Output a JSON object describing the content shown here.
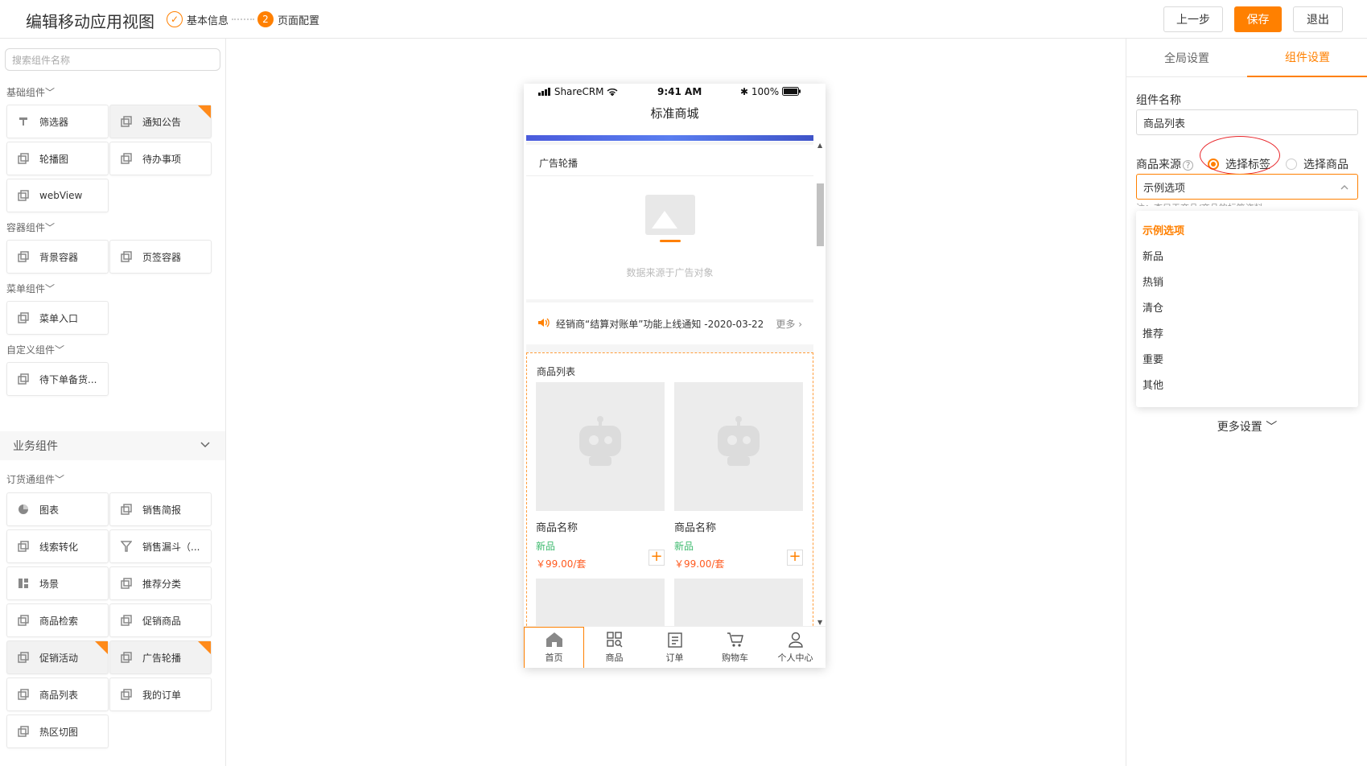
{
  "header": {
    "title": "编辑移动应用视图",
    "step1": "基本信息",
    "step2_num": "2",
    "step2": "页面配置",
    "prev": "上一步",
    "save": "保存",
    "exit": "退出"
  },
  "left": {
    "search_placeholder": "搜索组件名称",
    "groups": {
      "basic": "基础组件",
      "container": "容器组件",
      "menu": "菜单组件",
      "custom": "自定义组件",
      "business": "业务组件",
      "order": "订货通组件"
    },
    "basic_items": [
      "筛选器",
      "通知公告",
      "轮播图",
      "待办事项",
      "webView"
    ],
    "container_items": [
      "背景容器",
      "页签容器"
    ],
    "menu_items": [
      "菜单入口"
    ],
    "custom_items": [
      "待下单备货..."
    ],
    "order_items": [
      "图表",
      "销售简报",
      "线索转化",
      "销售漏斗（...",
      "场景",
      "推荐分类",
      "商品检索",
      "促销商品",
      "促销活动",
      "广告轮播",
      "商品列表",
      "我的订单",
      "热区切图"
    ]
  },
  "phone": {
    "carrier": "ShareCRM",
    "time": "9:41 AM",
    "battery": "100%",
    "nav_title": "标准商城",
    "ad_title": "广告轮播",
    "ad_note": "数据来源于广告对象",
    "notice": "经销商“结算对账单”功能上线通知 -2020-03-22",
    "notice_more": "更多",
    "list_title": "商品列表",
    "products": [
      {
        "name": "商品名称",
        "tag": "新品",
        "price": "￥99.00/套"
      },
      {
        "name": "商品名称",
        "tag": "新品",
        "price": "￥99.00/套"
      }
    ],
    "tabs": [
      "首页",
      "商品",
      "订单",
      "购物车",
      "个人中心"
    ]
  },
  "right": {
    "tab_global": "全局设置",
    "tab_component": "组件设置",
    "name_label": "组件名称",
    "name_value": "商品列表",
    "source_label": "商品来源",
    "radio_tag": "选择标签",
    "radio_product": "选择商品",
    "select_value": "示例选项",
    "hint": "注：查只于商品/商品的标签资料",
    "options": [
      "示例选项",
      "新品",
      "热销",
      "清仓",
      "推荐",
      "重要",
      "其他"
    ],
    "more_settings": "更多设置"
  }
}
